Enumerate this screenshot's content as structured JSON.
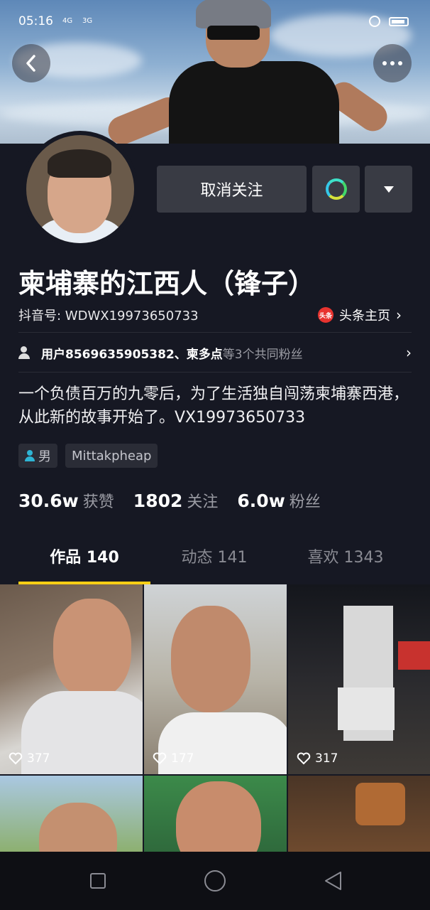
{
  "status_bar": {
    "time": "05:16",
    "network_1": "4G",
    "network_2": "3G"
  },
  "profile": {
    "action_button": "取消关注",
    "name": "柬埔寨的江西人（锋子）",
    "douyin_id": "抖音号: WDWX19973650733",
    "toutiao_icon": "头条",
    "toutiao_link": "头条主页",
    "mutual": {
      "names": "用户8569635905382、柬多点",
      "suffix": "等3个共同粉丝"
    },
    "bio": "一个负债百万的九零后，为了生活独自闯荡柬埔寨西港，从此新的故事开始了。VX19973650733",
    "tags": {
      "gender": "男",
      "location": "Mittakpheap"
    },
    "stats": [
      {
        "value": "30.6w",
        "label": "获赞"
      },
      {
        "value": "1802",
        "label": "关注"
      },
      {
        "value": "6.0w",
        "label": "粉丝"
      }
    ]
  },
  "tabs": {
    "works": "作品 140",
    "dynamic": "动态 141",
    "likes": "喜欢 1343"
  },
  "videos": [
    {
      "likes": "377"
    },
    {
      "likes": "177"
    },
    {
      "likes": "317"
    }
  ],
  "icons": {
    "back": "chevron-left-icon",
    "more": "more-dots-icon",
    "chat": "chat-bubble-icon",
    "dropdown": "dropdown-triangle-icon",
    "mutual": "users-icon",
    "gender": "person-icon",
    "heart": "heart-icon"
  },
  "colors": {
    "background": "#161823",
    "button": "#393b44",
    "tab_underline": "#face15",
    "muted_text": "#9a9ba3",
    "toutiao_red": "#e8332f"
  }
}
